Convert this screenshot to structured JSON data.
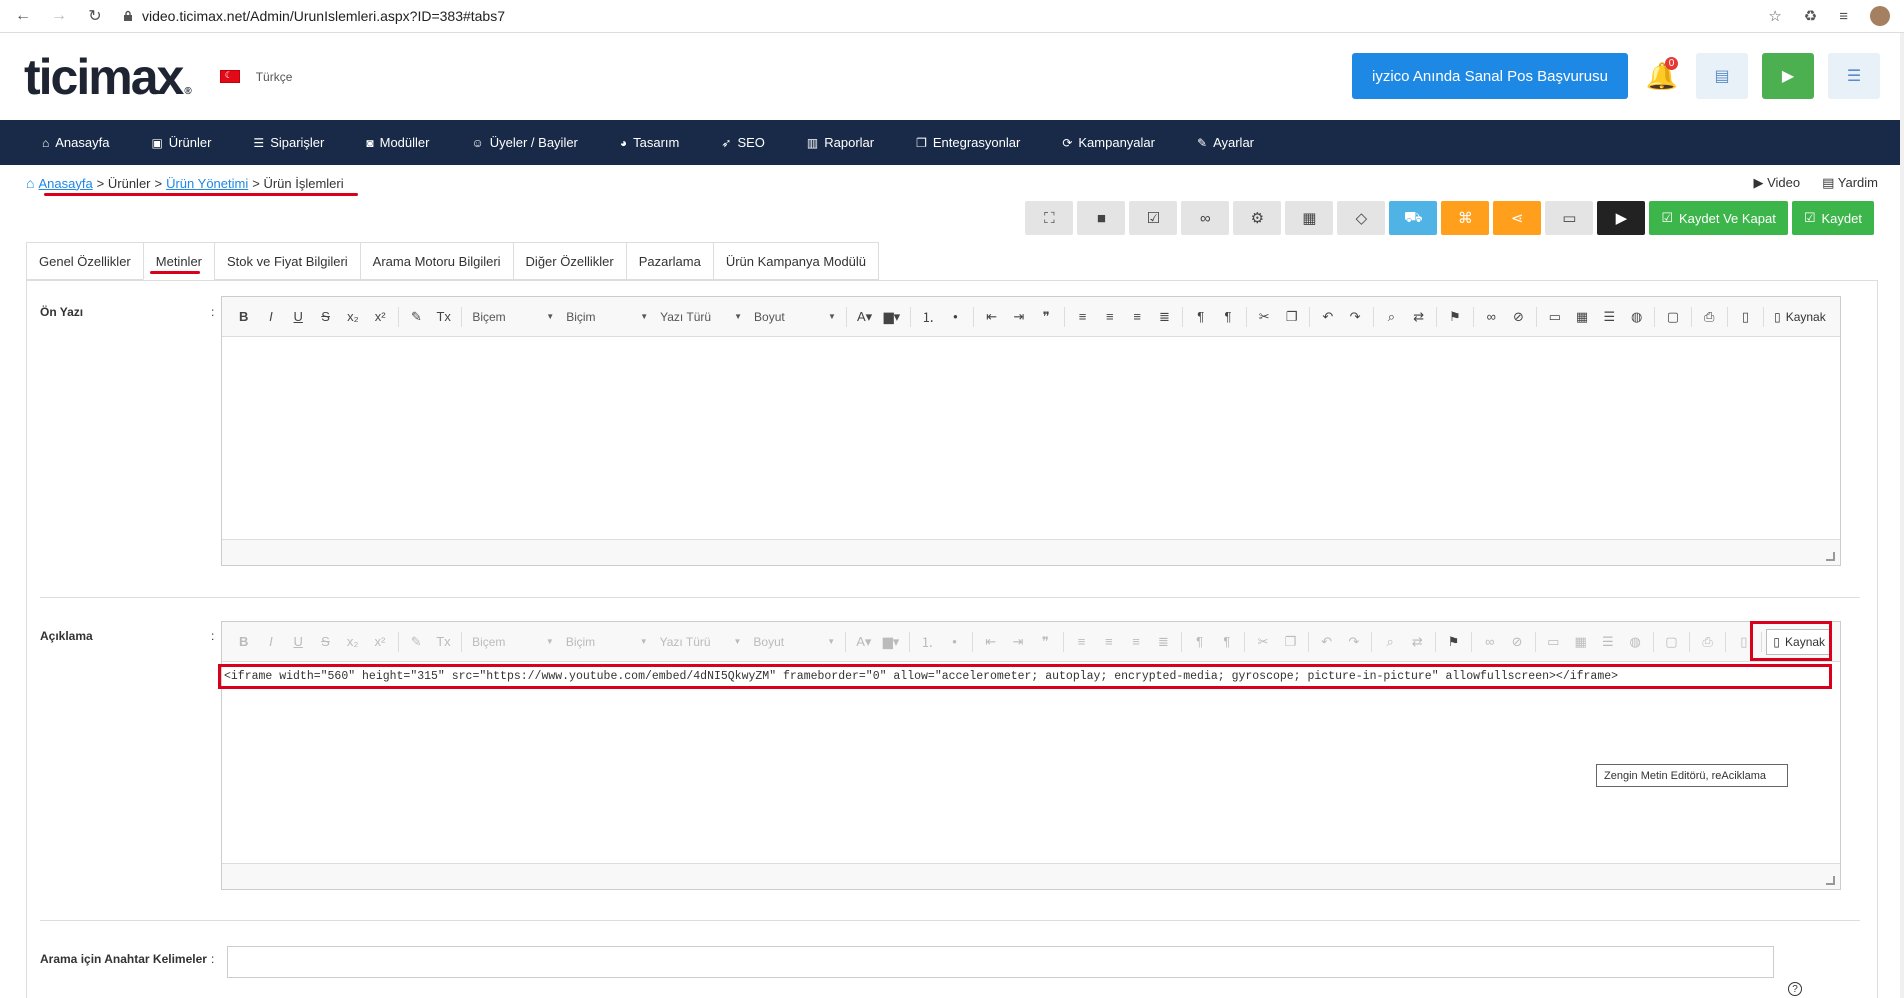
{
  "browser": {
    "url": "video.ticimax.net/Admin/UrunIslemleri.aspx?ID=383#tabs7"
  },
  "header": {
    "logo": "ticimax",
    "logo_mark": "®",
    "language": "Türkçe",
    "iyzico_button": "iyzico Anında Sanal Pos Başvurusu",
    "notification_count": "0"
  },
  "nav": {
    "items": [
      {
        "label": "Anasayfa",
        "icon": "home-icon"
      },
      {
        "label": "Ürünler",
        "icon": "box-icon"
      },
      {
        "label": "Siparişler",
        "icon": "list-icon"
      },
      {
        "label": "Modüller",
        "icon": "camera-icon"
      },
      {
        "label": "Üyeler / Bayiler",
        "icon": "user-icon"
      },
      {
        "label": "Tasarım",
        "icon": "palette-icon"
      },
      {
        "label": "SEO",
        "icon": "rocket-icon"
      },
      {
        "label": "Raporlar",
        "icon": "chart-icon"
      },
      {
        "label": "Entegrasyonlar",
        "icon": "copy-icon"
      },
      {
        "label": "Kampanyalar",
        "icon": "refresh-icon"
      },
      {
        "label": "Ayarlar",
        "icon": "wrench-icon"
      }
    ]
  },
  "breadcrumb": {
    "home": "Anasayfa",
    "products": "> Ürünler",
    "management": "Ürün Yönetimi",
    "current": "> Ürün İşlemleri",
    "sep": ">"
  },
  "help": {
    "video": "Video",
    "help": "Yardim"
  },
  "actions": {
    "save_close": "Kaydet Ve Kapat",
    "save": "Kaydet"
  },
  "tabs": [
    "Genel Özellikler",
    "Metinler",
    "Stok ve Fiyat Bilgileri",
    "Arama Motoru Bilgileri",
    "Diğer Özellikler",
    "Pazarlama",
    "Ürün Kampanya Modülü"
  ],
  "fields": {
    "on_yazi": "Ön Yazı",
    "aciklama": "Açıklama",
    "keywords": "Arama için Anahtar Kelimeler",
    "colon": ":"
  },
  "editor": {
    "style_combo": "Biçem",
    "format_combo": "Biçim",
    "font_combo": "Yazı Türü",
    "size_combo": "Boyut",
    "source": "Kaynak",
    "source_content": "<iframe width=\"560\" height=\"315\" src=\"https://www.youtube.com/embed/4dNI5QkwyZM\" frameborder=\"0\" allow=\"accelerometer; autoplay; encrypted-media; gyroscope; picture-in-picture\" allowfullscreen></iframe>",
    "tooltip": "Zengin Metin Editörü, reAciklama"
  },
  "colors": {
    "nav_bg": "#182a47",
    "accent_blue": "#1e88e5",
    "save_green": "#3cb54b",
    "highlight_red": "#d9001b"
  }
}
